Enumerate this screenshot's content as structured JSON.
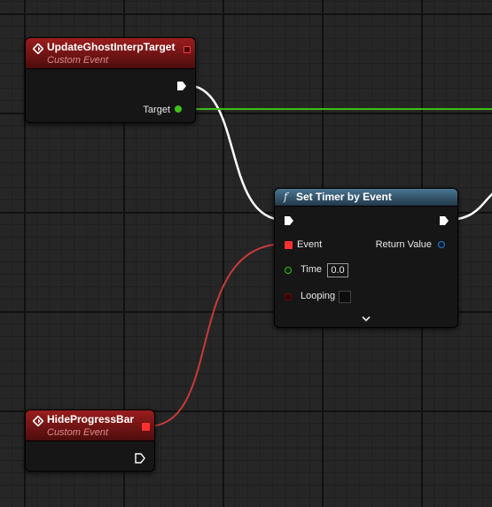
{
  "nodes": {
    "update_ghost": {
      "title": "UpdateGhostInterpTarget",
      "subtitle": "Custom Event",
      "target_label": "Target"
    },
    "set_timer": {
      "fn_symbol": "f",
      "title": "Set Timer by Event",
      "event_label": "Event",
      "return_label": "Return Value",
      "time_label": "Time",
      "time_value": "0.0",
      "looping_label": "Looping",
      "looping_checked": false,
      "expand_icon": "chevron-down"
    },
    "hide_progress": {
      "title": "HideProgressBar",
      "subtitle": "Custom Event"
    }
  },
  "colors": {
    "grid_background": "#262626",
    "event_header": "#9a1d1d",
    "function_header": "#4a7590",
    "exec_wire": "#ffffff",
    "object_wire": "#3fc01a",
    "delegate_wire": "#d03a3a",
    "float_pin": "#3fc01a",
    "bool_pin": "#8a0000",
    "return_pin": "#1f7dd6"
  }
}
